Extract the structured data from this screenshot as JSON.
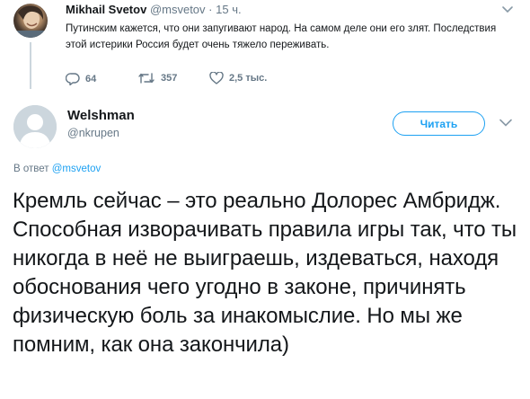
{
  "parent_tweet": {
    "author_name": "Mikhail Svetov",
    "author_handle": "@msvetov",
    "separator": "·",
    "time": "15 ч.",
    "text": "Путинским кажется, что они запугивают народ. На самом деле они его злят. Последствия этой истерики Россия будет очень тяжело переживать.",
    "replies": "64",
    "retweets": "357",
    "likes": "2,5 тыс."
  },
  "main_tweet": {
    "author_name": "Welshman",
    "author_handle": "@nkrupen",
    "follow_label": "Читать",
    "reply_prefix": "В ответ",
    "reply_handle": "@msvetov",
    "text": "Кремль сейчас – это реально Долорес Амбридж. Способная изворачивать правила игры так, что ты никогда в неё не выиграешь, издеваться, находя обоснования чего угодно в законе, причинять физическую боль за инакомыслие. Но мы же помним, как она закончила)"
  },
  "colors": {
    "accent": "#1da1f2",
    "secondary_text": "#657786",
    "primary_text": "#14171a",
    "avatar_placeholder": "#ccd6dd"
  },
  "icons": {
    "reply": "reply-icon",
    "retweet": "retweet-icon",
    "like": "heart-icon",
    "more": "chevron-down-icon",
    "default_avatar": "default-avatar-icon"
  }
}
